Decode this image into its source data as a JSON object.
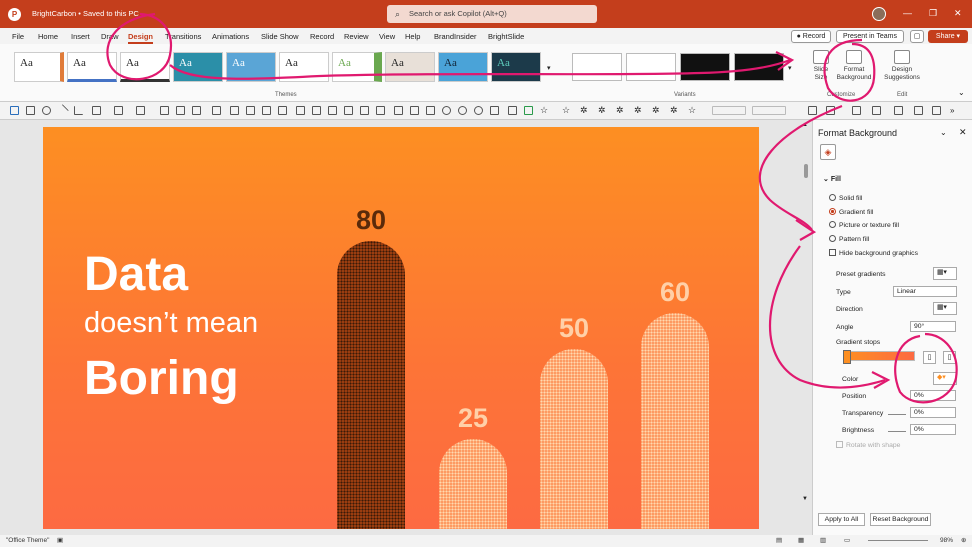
{
  "titlebar": {
    "doc_title": "BrightCarbon • Saved to this PC",
    "search_placeholder": "Search or ask Copilot (Alt+Q)"
  },
  "menu": {
    "tabs": [
      "File",
      "Home",
      "Insert",
      "Draw",
      "Design",
      "Transitions",
      "Animations",
      "Slide Show",
      "Record",
      "Review",
      "View",
      "Help",
      "BrandInsider",
      "BrightSlide"
    ],
    "record": "Record",
    "teams": "Present in Teams",
    "share": "Share"
  },
  "ribbon": {
    "themes_label": "Themes",
    "variants_label": "Variants",
    "customize_label": "Customize",
    "edit_label": "Edit",
    "theme_sample": "Aa",
    "slide_size": "Slide Size",
    "format_background": "Format Background",
    "design_suggestions": "Design Suggestions"
  },
  "slide": {
    "line1": "Data",
    "line2": "doesn’t mean",
    "line3": "Boring",
    "bars": [
      "80",
      "25",
      "50",
      "60"
    ]
  },
  "bars_values": [
    80,
    25,
    50,
    60
  ],
  "panel": {
    "title": "Format Background",
    "fill_header": "Fill",
    "solid": "Solid fill",
    "gradient": "Gradient fill",
    "picture": "Picture or texture fill",
    "pattern": "Pattern fill",
    "hide_bg": "Hide background graphics",
    "preset": "Preset gradients",
    "type_label": "Type",
    "type_value": "Linear",
    "direction": "Direction",
    "angle_label": "Angle",
    "angle_value": "90°",
    "stops": "Gradient stops",
    "color": "Color",
    "position_label": "Position",
    "position_value": "0%",
    "transparency_label": "Transparency",
    "transparency_value": "0%",
    "brightness_label": "Brightness",
    "brightness_value": "0%",
    "rotate": "Rotate with shape",
    "apply_all": "Apply to All",
    "reset": "Reset Background"
  },
  "status": {
    "theme": "\"Office Theme\"",
    "zoom": "98%"
  },
  "colors": {
    "accent": "#c43e1c",
    "annotation": "#e0196f"
  }
}
